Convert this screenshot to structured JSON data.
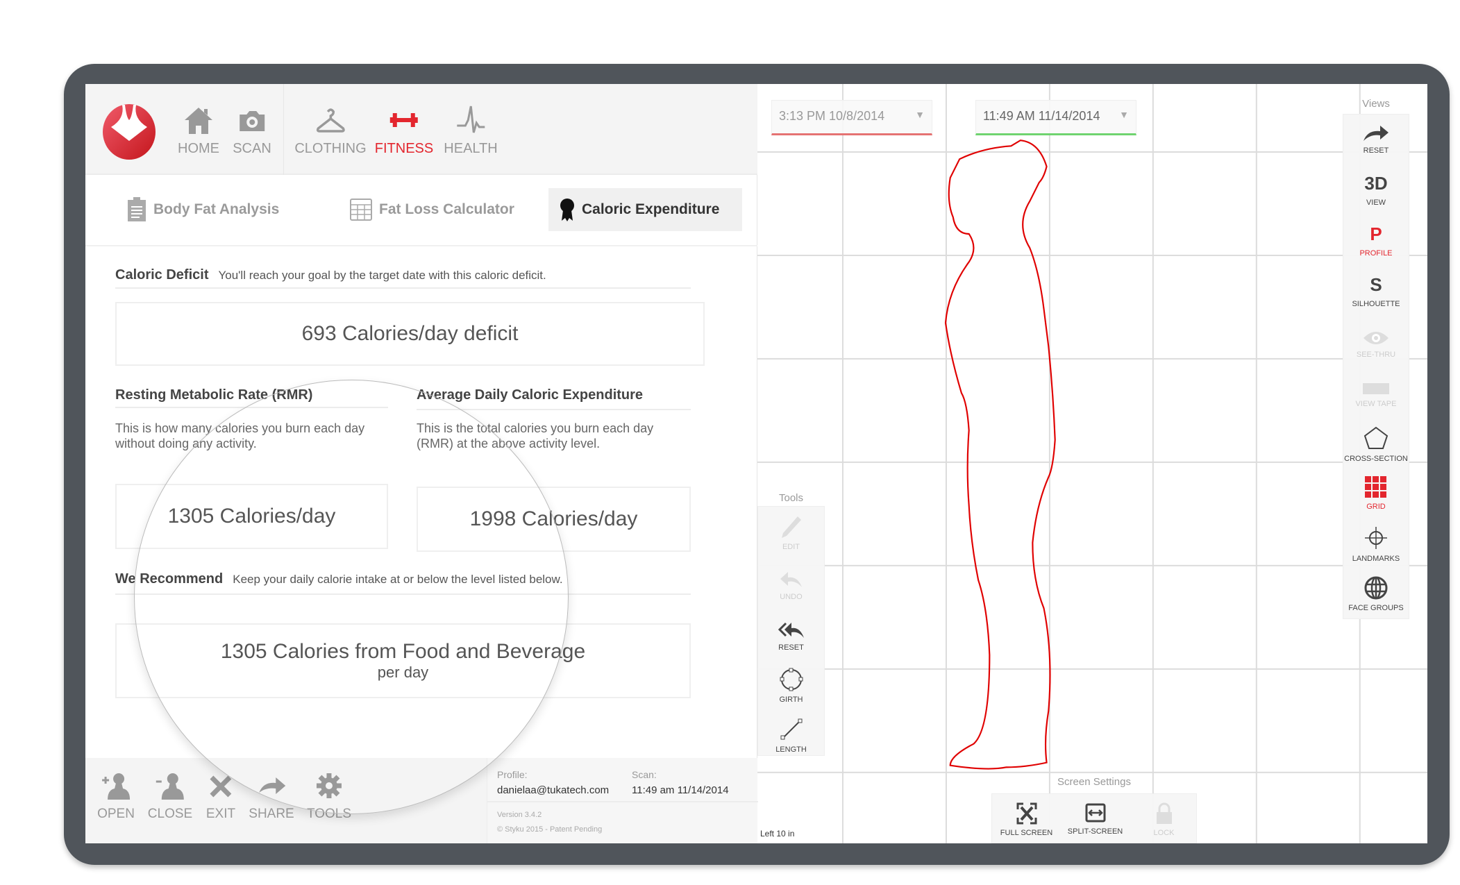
{
  "colors": {
    "accent": "#e3262e",
    "bezel": "#50555b",
    "deficit_underline": "#e57373",
    "scan_underline": "#6fd36f",
    "silhouette": "#e00000"
  },
  "nav": {
    "items": [
      {
        "label": "HOME",
        "icon": "home-icon",
        "active": false
      },
      {
        "label": "SCAN",
        "icon": "camera-icon",
        "active": false
      },
      {
        "label": "CLOTHING",
        "icon": "hanger-icon",
        "active": false
      },
      {
        "label": "FITNESS",
        "icon": "dumbbell-icon",
        "active": true
      },
      {
        "label": "HEALTH",
        "icon": "heartbeat-icon",
        "active": false
      }
    ]
  },
  "subtabs": [
    {
      "label": "Body Fat Analysis",
      "icon": "clipboard-icon",
      "active": false
    },
    {
      "label": "Fat Loss Calculator",
      "icon": "calculator-icon",
      "active": false
    },
    {
      "label": "Caloric Expenditure",
      "icon": "award-ribbon-icon",
      "active": true
    }
  ],
  "deficit": {
    "title": "Caloric Deficit",
    "subtitle": "You'll reach your goal by the target date with this caloric deficit.",
    "value": "693 Calories/day deficit"
  },
  "rmr": {
    "title": "Resting Metabolic Rate (RMR)",
    "desc1": "This is how many calories you burn each day",
    "desc2": "without doing any activity.",
    "value": "1305 Calories/day"
  },
  "adce": {
    "title": "Average Daily Caloric Expenditure",
    "desc1": "This is the total calories you burn each day",
    "desc2": "(RMR) at the above activity level.",
    "value": "1998 Calories/day"
  },
  "recommend": {
    "title": "We Recommend",
    "subtitle": "Keep your daily calorie intake at or below the level listed below.",
    "value": "1305 Calories from Food and Beverage",
    "per": "per day"
  },
  "footer": {
    "buttons": [
      {
        "label": "OPEN"
      },
      {
        "label": "CLOSE"
      },
      {
        "label": "EXIT"
      },
      {
        "label": "SHARE"
      },
      {
        "label": "TOOLS"
      }
    ],
    "profile_label": "Profile:",
    "profile_value": "danielaa@tukatech.com",
    "scan_label": "Scan:",
    "scan_value": "11:49 am 11/14/2014",
    "version": "Version 3.4.2",
    "copyright": "© Styku 2015 - Patent Pending"
  },
  "viewer": {
    "scan1": "3:13 PM 10/8/2014",
    "scan2": "11:49 AM 11/14/2014",
    "views_title": "Views",
    "views": [
      {
        "label": "RESET"
      },
      {
        "label": "VIEW",
        "glyph": "3D"
      },
      {
        "label": "PROFILE",
        "glyph": "P"
      },
      {
        "label": "SILHOUETTE",
        "glyph": "S"
      },
      {
        "label": "SEE-THRU"
      },
      {
        "label": "VIEW TAPE"
      },
      {
        "label": "CROSS-SECTION"
      },
      {
        "label": "GRID"
      },
      {
        "label": "LANDMARKS"
      },
      {
        "label": "FACE GROUPS"
      }
    ],
    "tools_title": "Tools",
    "tools": [
      {
        "label": "EDIT"
      },
      {
        "label": "UNDO"
      },
      {
        "label": "RESET"
      },
      {
        "label": "GIRTH"
      },
      {
        "label": "LENGTH"
      }
    ],
    "screen_settings_title": "Screen Settings",
    "screen_settings": [
      {
        "label": "FULL SCREEN"
      },
      {
        "label": "SPLIT-SCREEN"
      },
      {
        "label": "LOCK"
      }
    ],
    "status": "Left 10 in"
  }
}
